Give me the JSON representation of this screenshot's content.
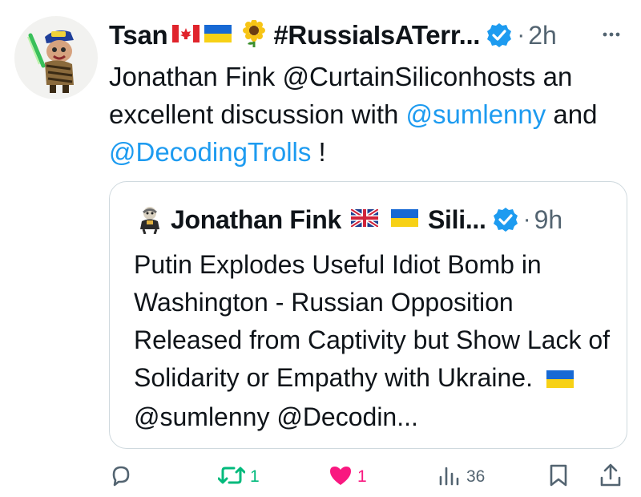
{
  "author": {
    "name": "Tsan",
    "handle_display": "#RussiaIsATerr...",
    "time": "2h",
    "dot": "·",
    "more": "···"
  },
  "body": {
    "part1": "Jonathan Fink @CurtainSiliconhosts an excellent discussion with ",
    "mention1": "@sumlenny",
    "part2": " and ",
    "mention2": "@DecodingTrolls",
    "part3": " !"
  },
  "quote": {
    "name": "Jonathan Fink",
    "handle_display": "Sili...",
    "time": "9h",
    "dot": "·",
    "text_part1": "Putin Explodes Useful Idiot Bomb in Washington - Russian Opposition Released from Captivity but Show Lack of Solidarity or Empathy with Ukraine.",
    "text_part2": "@sumlenny @Decodin..."
  },
  "actions": {
    "reply_count": "",
    "retweet_count": "1",
    "like_count": "1",
    "views_count": "36"
  },
  "colors": {
    "accent": "#1d9bf0",
    "retweet": "#00ba7c",
    "like": "#f91880",
    "muted": "#536471"
  }
}
